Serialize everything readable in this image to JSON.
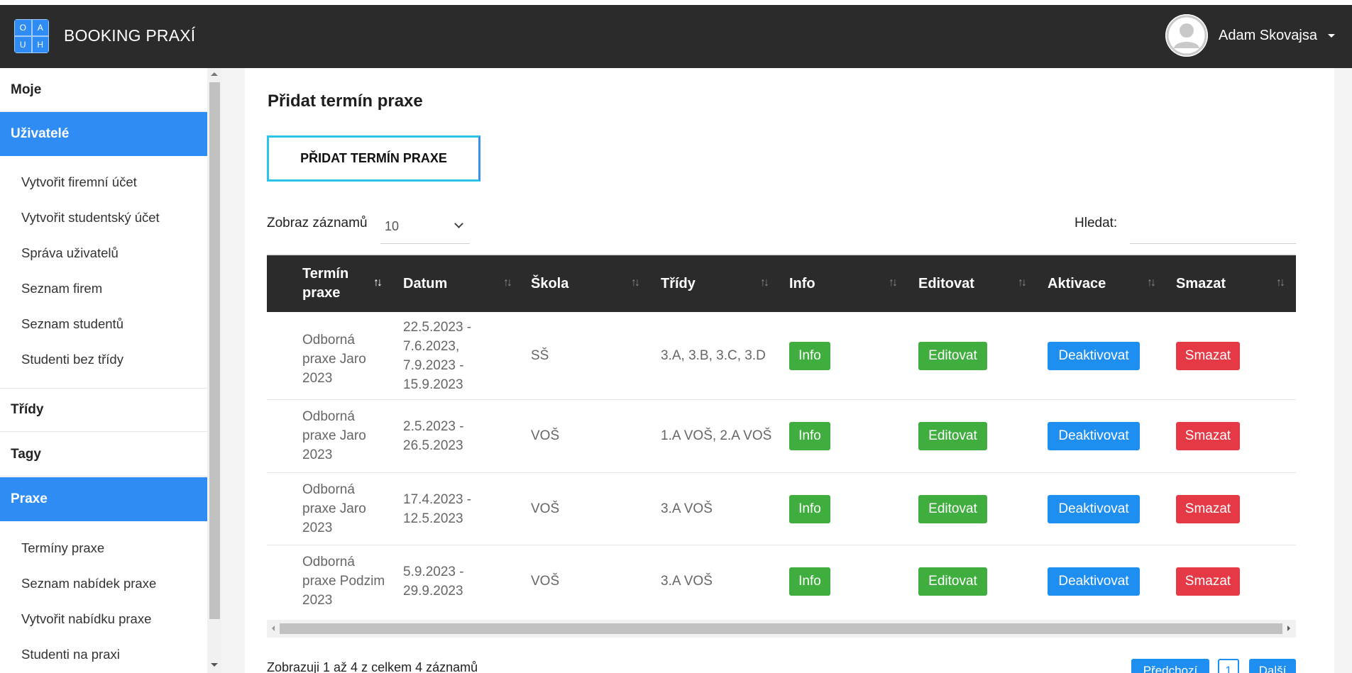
{
  "navbar": {
    "logo_letters": [
      "O",
      "A",
      "U",
      "H"
    ],
    "brand": "BOOKING PRAXÍ",
    "user_name": "Adam Skovajsa",
    "avatar_icon": "user-avatar-icon",
    "caret_icon": "caret-down-icon"
  },
  "sidebar": {
    "sections": [
      {
        "label": "Moje",
        "active": false
      },
      {
        "label": "Uživatelé",
        "active": true
      },
      {
        "label": "Třídy",
        "active": false
      },
      {
        "label": "Tagy",
        "active": false
      },
      {
        "label": "Praxe",
        "active": true
      }
    ],
    "users_items": [
      "Vytvořit firemní účet",
      "Vytvořit studentský účet",
      "Správa uživatelů",
      "Seznam firem",
      "Seznam studentů",
      "Studenti bez třídy"
    ],
    "praxe_items": [
      "Termíny praxe",
      "Seznam nabídek praxe",
      "Vytvořit nabídku praxe",
      "Studenti na praxi"
    ]
  },
  "main": {
    "title": "Přidat termín praxe",
    "add_button": "PŘIDAT TERMÍN PRAXE",
    "length_label": "Zobraz záznamů",
    "length_value": "10",
    "search_label": "Hledat:",
    "search_value": ""
  },
  "table": {
    "headers": [
      "Termín praxe",
      "Datum",
      "Škola",
      "Třídy",
      "Info",
      "Editovat",
      "Aktivace",
      "Smazat"
    ],
    "rows": [
      {
        "term": "Odborná praxe Jaro 2023",
        "date": "22.5.2023 - 7.6.2023, 7.9.2023 - 15.9.2023",
        "school": "SŠ",
        "classes": "3.A, 3.B, 3.C, 3.D",
        "info": "Info",
        "edit": "Editovat",
        "activation": "Deaktivovat",
        "delete": "Smazat"
      },
      {
        "term": "Odborná praxe Jaro 2023",
        "date": "2.5.2023 - 26.5.2023",
        "school": "VOŠ",
        "classes": "1.A VOŠ, 2.A VOŠ",
        "info": "Info",
        "edit": "Editovat",
        "activation": "Deaktivovat",
        "delete": "Smazat"
      },
      {
        "term": "Odborná praxe Jaro 2023",
        "date": "17.4.2023 - 12.5.2023",
        "school": "VOŠ",
        "classes": "3.A VOŠ",
        "info": "Info",
        "edit": "Editovat",
        "activation": "Deaktivovat",
        "delete": "Smazat"
      },
      {
        "term": "Odborná praxe Podzim 2023",
        "date": "5.9.2023 - 29.9.2023",
        "school": "VOŠ",
        "classes": "3.A VOŠ",
        "info": "Info",
        "edit": "Editovat",
        "activation": "Deaktivovat",
        "delete": "Smazat"
      }
    ]
  },
  "footer": {
    "info": "Zobrazuji 1 až 4 z celkem 4 záznamů",
    "prev": "Předchozí",
    "page": "1",
    "next": "Další"
  },
  "colors": {
    "navbar": "#2b2b2b",
    "accent": "#2f8cf5",
    "green": "#3fae3f",
    "blue": "#1e8ef1",
    "red": "#e63946"
  }
}
